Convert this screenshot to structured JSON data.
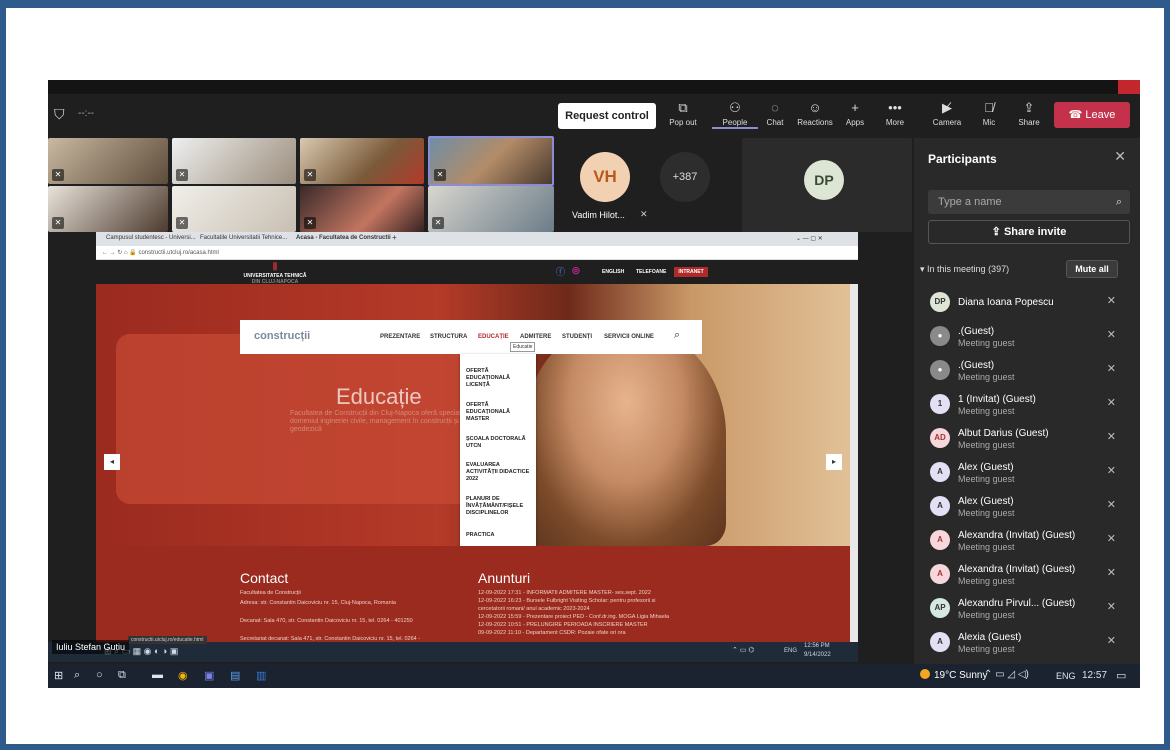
{
  "toolbar": {
    "request_control": "Request control",
    "pop_out": "Pop out",
    "people": "People",
    "chat": "Chat",
    "reactions": "Reactions",
    "apps": "Apps",
    "more": "More",
    "camera": "Camera",
    "mic": "Mic",
    "share": "Share",
    "leave": "Leave",
    "timer": "--:--"
  },
  "stage": {
    "vh_initials": "VH",
    "vh_name": "Vadim Hilot...",
    "more_count": "+387",
    "dp_initials": "DP"
  },
  "panel": {
    "title": "Participants",
    "search_placeholder": "Type a name",
    "share_invite": "Share invite",
    "in_meeting": "In this meeting (397)",
    "mute_all": "Mute all",
    "participants": [
      {
        "initials": "DP",
        "name": "Diana Ioana Popescu",
        "sub": ""
      },
      {
        "initials": "",
        "name": ".(Guest)",
        "sub": "Meeting guest"
      },
      {
        "initials": "",
        "name": ".(Guest)",
        "sub": "Meeting guest"
      },
      {
        "initials": "1",
        "name": "1 (Invitat) (Guest)",
        "sub": "Meeting guest"
      },
      {
        "initials": "AD",
        "name": "Albut Darius (Guest)",
        "sub": "Meeting guest"
      },
      {
        "initials": "A",
        "name": "Alex (Guest)",
        "sub": "Meeting guest"
      },
      {
        "initials": "A",
        "name": "Alex (Guest)",
        "sub": "Meeting guest"
      },
      {
        "initials": "A",
        "name": "Alexandra (Invitat) (Guest)",
        "sub": "Meeting guest"
      },
      {
        "initials": "A",
        "name": "Alexandra (Invitat) (Guest)",
        "sub": "Meeting guest"
      },
      {
        "initials": "AP",
        "name": "Alexandru Pirvul... (Guest)",
        "sub": "Meeting guest"
      },
      {
        "initials": "A",
        "name": "Alexia (Guest)",
        "sub": "Meeting guest"
      }
    ]
  },
  "browser": {
    "tab1": "Campusul studentesc - Universi...",
    "tab2": "Facultatile Universitatii Tehnice...",
    "tab3": "Acasa - Facultatea de Constructii",
    "url": "constructii.utcluj.ro/acasa.html",
    "site_logo": "UNIVERSITATEA TEHNICĂ",
    "site_logo_sub": "DIN CLUJ-NAPOCA",
    "lang_english": "ENGLISH",
    "telefoane": "TELEFOANE",
    "intranet": "INTRANET",
    "brand": "construcții",
    "nav": [
      "PREZENTARE",
      "STRUCTURA",
      "EDUCAȚIE",
      "ADMITERE",
      "STUDENȚI",
      "SERVICII ONLINE"
    ],
    "tooltip": "Educatie",
    "dropdown": [
      "OFERTĂ EDUCAȚIONALĂ LICENȚĂ",
      "OFERTĂ EDUCAȚIONALĂ MASTER",
      "ȘCOALA DOCTORALĂ UTCN",
      "EVALUAREA ACTIVITĂȚII DIDACTICE 2022",
      "PLANURI DE ÎNVĂȚĂMÂNT/FIȘELE DISCIPLINELOR",
      "PRACTICA"
    ],
    "hero_title": "Educație",
    "hero_sub": "Facultatea de Construcții din Cluj-Napoca oferă specializări în domeniul ingineriei civile, management în construcții și ingineria geodezică",
    "contact_title": "Contact",
    "contact_lines": [
      "Facultatea de Construcții",
      "Adresa: str. Constantin Daicoviciu nr. 15, Cluj-Napoca, Romania",
      "Decanat: Sala 470, str. Constantin Daicoviciu nr. 15, tel. 0264 - 401250",
      "Secretariat decanat: Sala 471, str. Constantin Daicoviciu nr. 15, tel. 0264 -"
    ],
    "anunturi_title": "Anunturi",
    "anunturi": [
      "12-09-2022 17:31 - INFORMATII ADMITERE MASTER- ses.sept. 2022",
      "12-09-2022 16:23 - Bursele Fulbright Visiting Scholar: pentru profesorii si",
      "cercetatorii romani/ anul academic 2023-2024",
      "12-09-2022 15:59 - Prezentare proiect PED - Conf.dr.ing. MOGA Ligia Mihaela",
      "12-09-2022 10:51 - PRELUNGIRE PERIOADA INSCRIERE MASTER",
      "09-09-2022 11:10 - Departament CSDR: Pozaie ofate ori ora"
    ],
    "status_url": "constructii.utcluj.ro/educatie.html",
    "inner_time": "12:56 PM",
    "inner_date": "9/14/2022",
    "inner_lang": "ENG"
  },
  "presenter_name": "Iuliu Stefan Gutiu",
  "taskbar": {
    "weather": "19°C Sunny",
    "lang": "ENG",
    "time": "12:57"
  },
  "colors": {
    "accent": "#8b8cd6",
    "leave": "#c4314b",
    "utcn_red": "#9b2a1f"
  }
}
